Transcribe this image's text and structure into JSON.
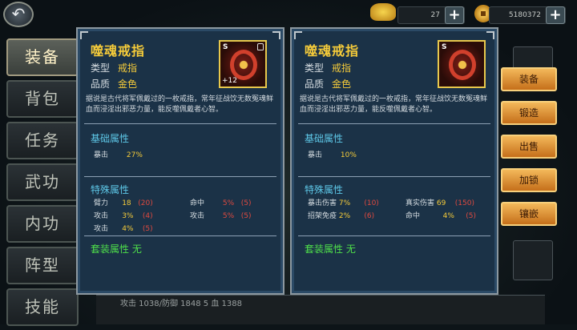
{
  "resources": {
    "gold_ingot": "27",
    "coins": "5180372"
  },
  "tabs": [
    "装备",
    "背包",
    "任务",
    "武功",
    "内功",
    "阵型",
    "技能"
  ],
  "left_panel": {
    "name": "噬魂戒指",
    "type_label": "类型",
    "type_value": "戒指",
    "quality_label": "品质",
    "quality_value": "金色",
    "item": {
      "grade": "S",
      "plus": "+12"
    },
    "description": "据说是古代将军佩戴过的一枚戒指，常年征战饮无数冤魂鲜血而浸淫出邪恶力量，能反噬佩戴者心智。",
    "base_title": "基础属性",
    "base": {
      "label": "暴击",
      "value": "27%"
    },
    "special_title": "特殊属性",
    "special": [
      {
        "label": "臂力",
        "value": "18",
        "extra": "(20)"
      },
      {
        "label": "命中",
        "value": "5%",
        "extra": "(5)"
      },
      {
        "label": "攻击",
        "value": "3%",
        "extra": "(4)"
      },
      {
        "label": "攻击",
        "value": "5%",
        "extra": "(5)"
      },
      {
        "label": "攻击",
        "value": "4%",
        "extra": "(5)"
      }
    ],
    "suit": "套装属性 无"
  },
  "right_panel": {
    "name": "噬魂戒指",
    "type_label": "类型",
    "type_value": "戒指",
    "quality_label": "品质",
    "quality_value": "金色",
    "item": {
      "grade": "S"
    },
    "description": "据说是古代将军佩戴过的一枚戒指，常年征战饮无数冤魂鲜血而浸淫出邪恶力量，能反噬佩戴者心智。",
    "base_title": "基础属性",
    "base": {
      "label": "暴击",
      "value": "10%"
    },
    "special_title": "特殊属性",
    "special": [
      {
        "label": "暴击伤害",
        "value": "7%",
        "extra": "(10)"
      },
      {
        "label": "真实伤害",
        "value": "69",
        "extra": "(150)"
      },
      {
        "label": "招架免疫",
        "value": "2%",
        "extra": "(6)"
      },
      {
        "label": "命中",
        "value": "4%",
        "extra": "(5)"
      }
    ],
    "suit": "套装属性 无"
  },
  "actions": [
    "装备",
    "锻造",
    "出售",
    "加锁",
    "镶嵌"
  ],
  "bottom_text": "攻击 1038/防御 1848 5 血 1388"
}
